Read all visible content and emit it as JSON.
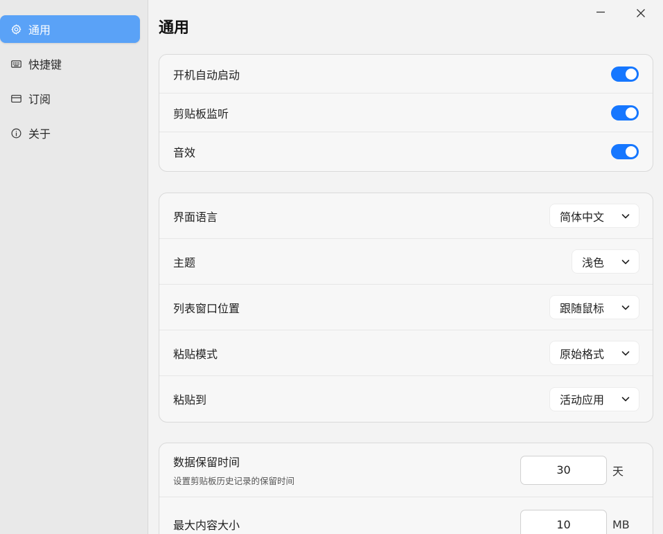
{
  "sidebar": {
    "items": [
      {
        "label": "通用",
        "icon": "gear-icon",
        "active": true
      },
      {
        "label": "快捷键",
        "icon": "keyboard-icon",
        "active": false
      },
      {
        "label": "订阅",
        "icon": "card-icon",
        "active": false
      },
      {
        "label": "关于",
        "icon": "info-icon",
        "active": false
      }
    ]
  },
  "main": {
    "title": "通用",
    "general": {
      "autostart": {
        "label": "开机自动启动",
        "on": true
      },
      "clipboard_monitor": {
        "label": "剪贴板监听",
        "on": true
      },
      "sound": {
        "label": "音效",
        "on": true
      }
    },
    "appearance": {
      "language": {
        "label": "界面语言",
        "value": "简体中文"
      },
      "theme": {
        "label": "主题",
        "value": "浅色"
      },
      "list_position": {
        "label": "列表窗口位置",
        "value": "跟随鼠标"
      },
      "paste_mode": {
        "label": "粘贴模式",
        "value": "原始格式"
      },
      "paste_to": {
        "label": "粘贴到",
        "value": "活动应用"
      }
    },
    "storage": {
      "retention": {
        "label": "数据保留时间",
        "desc": "设置剪贴板历史记录的保留时间",
        "value": "30",
        "unit": "天"
      },
      "max_size": {
        "label": "最大内容大小",
        "value": "10",
        "unit": "MB"
      }
    }
  },
  "colors": {
    "accent": "#1677ff",
    "sidebar_active": "#5aa2f7"
  }
}
